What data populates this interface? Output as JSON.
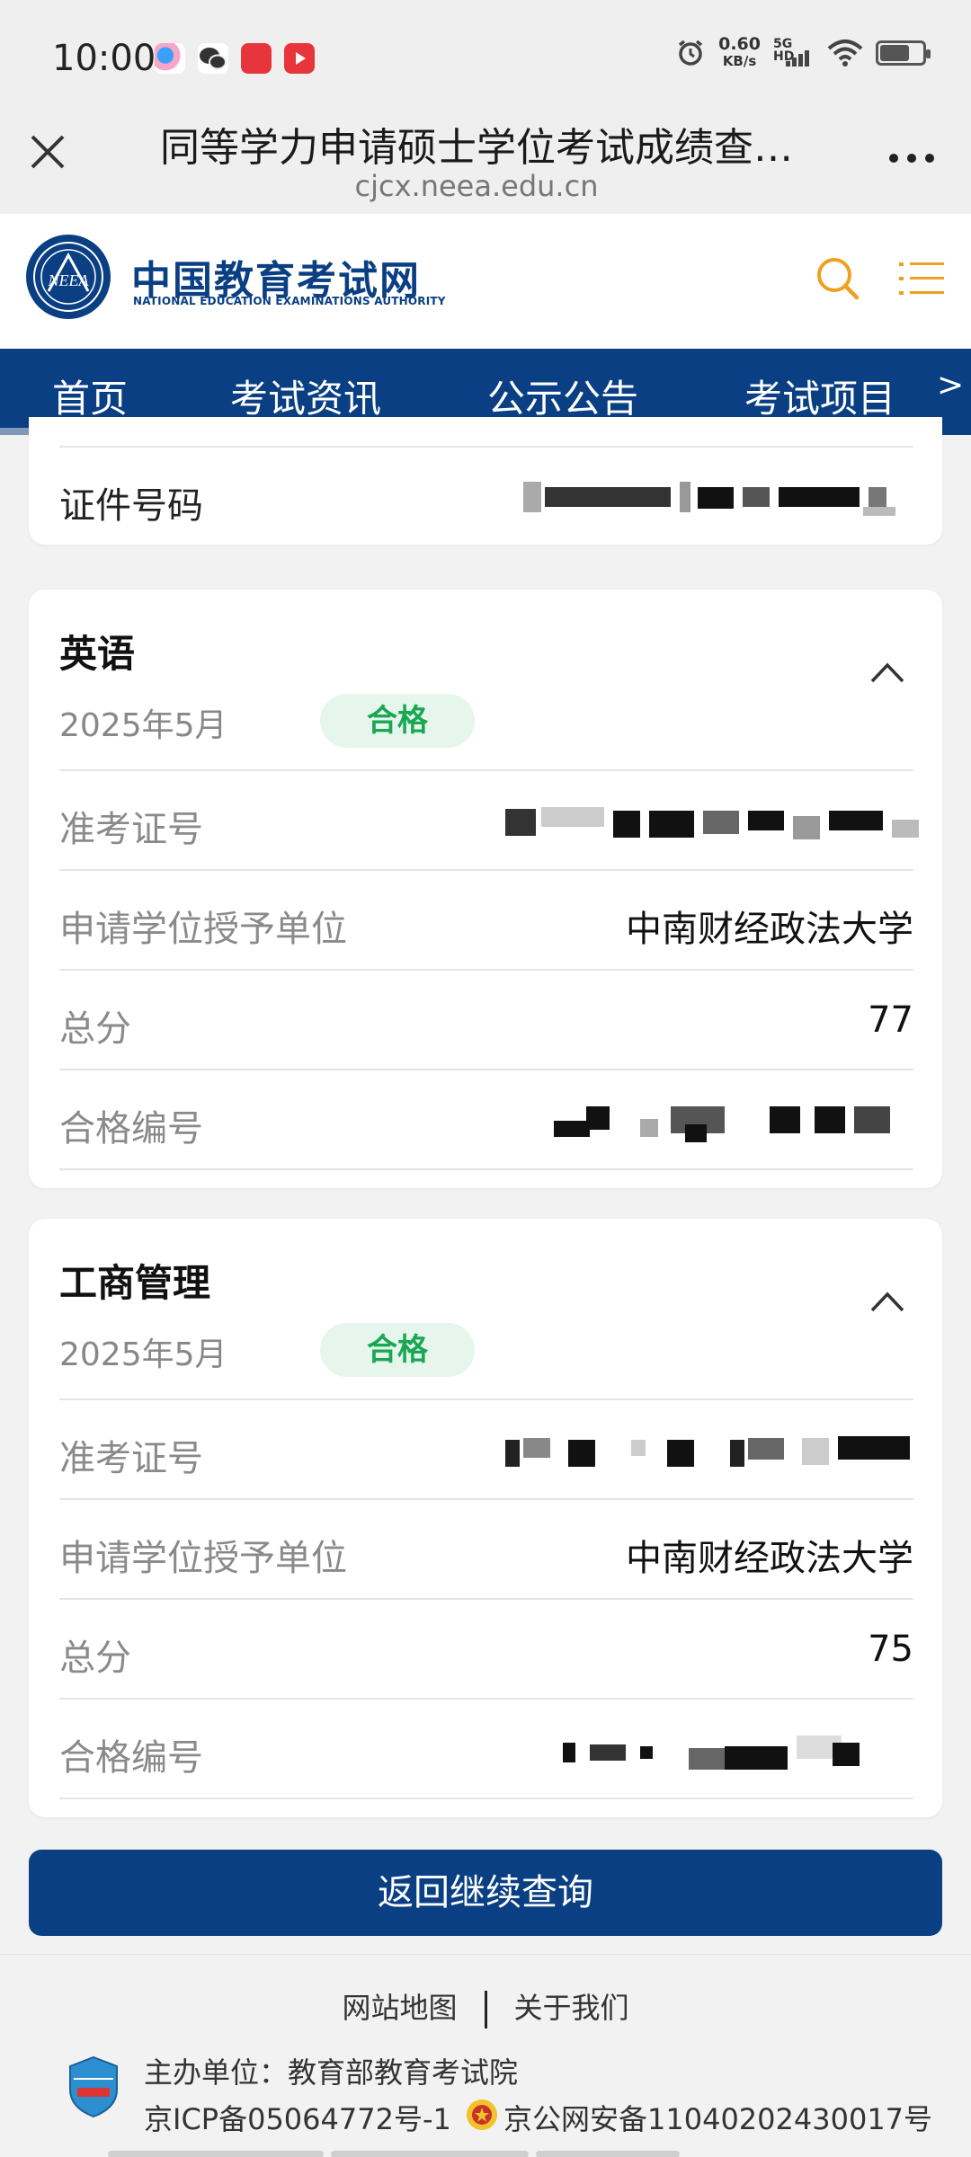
{
  "status_bar": {
    "time": "10:00",
    "net_speed_value": "0.60",
    "net_speed_unit": "KB/s",
    "network": "5G HD",
    "battery_level": 0.7
  },
  "browser": {
    "title": "同等学力申请硕士学位考试成绩查…",
    "url": "cjcx.neea.edu.cn",
    "more": "…"
  },
  "site": {
    "name_cn": "中国教育考试网",
    "name_en": "NATIONAL EDUCATION EXAMINATIONS AUTHORITY",
    "emblem_text": "NEEA"
  },
  "nav": {
    "items": [
      "首页",
      "考试资讯",
      "公示公告",
      "考试项目"
    ],
    "more_arrow": ">"
  },
  "id_card": {
    "label": "证件号码"
  },
  "results": [
    {
      "subject": "英语",
      "date": "2025年5月",
      "status": "合格",
      "rows": [
        {
          "label": "准考证号",
          "value": ""
        },
        {
          "label": "申请学位授予单位",
          "value": "中南财经政法大学"
        },
        {
          "label": "总分",
          "value": "77"
        },
        {
          "label": "合格编号",
          "value": ""
        }
      ]
    },
    {
      "subject": "工商管理",
      "date": "2025年5月",
      "status": "合格",
      "rows": [
        {
          "label": "准考证号",
          "value": ""
        },
        {
          "label": "申请学位授予单位",
          "value": "中南财经政法大学"
        },
        {
          "label": "总分",
          "value": "75"
        },
        {
          "label": "合格编号",
          "value": ""
        }
      ]
    }
  ],
  "back_button": "返回继续查询",
  "footer": {
    "link_sitemap": "网站地图",
    "link_about": "关于我们",
    "host": "主办单位：教育部教育考试院",
    "icp": "京ICP备05064772号-1",
    "police": "京公网安备11040202430017号"
  },
  "colors": {
    "brand_blue": "#0a3f83",
    "accent_orange": "#f0a020",
    "pass_green": "#1aa754"
  }
}
